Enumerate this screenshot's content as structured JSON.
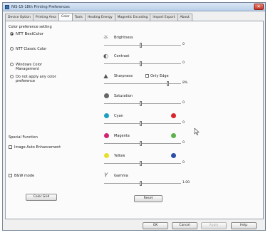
{
  "window": {
    "title": "NIS-15-18th Printing Preferences",
    "close_label": "✕"
  },
  "tabs": [
    {
      "label": "Device Option"
    },
    {
      "label": "Printing Area"
    },
    {
      "label": "Color"
    },
    {
      "label": "Tools"
    },
    {
      "label": "Heating Energy"
    },
    {
      "label": "Magnetic Encoding"
    },
    {
      "label": "Import Export"
    },
    {
      "label": "About"
    }
  ],
  "left": {
    "color_pref_heading": "Color preference setting",
    "opt_bestcolor": "NTT BestColor",
    "opt_classic": "NTT Classic Color",
    "opt_windows_line1": "Windows Color",
    "opt_windows_line2": "Management",
    "opt_none_line1": "Do not apply any color",
    "opt_none_line2": "preference",
    "special_heading": "Special Function",
    "image_auto": "Image Auto Enhancement",
    "bw_mode": "B&W mode",
    "color_grid_btn": "Color Grid"
  },
  "adjust": {
    "brightness": {
      "label": "Brightness",
      "value": "0"
    },
    "contrast": {
      "label": "Contrast",
      "value": "0"
    },
    "sharpness": {
      "label": "Sharpness",
      "edge_label": "Only Edge",
      "value": "8%"
    },
    "saturation": {
      "label": "Saturation",
      "value": "0"
    },
    "cyan": {
      "label": "Cyan",
      "value": "0"
    },
    "magenta": {
      "label": "Magenta",
      "value": "0"
    },
    "yellow": {
      "label": "Yellow",
      "value": "0"
    },
    "gamma": {
      "label": "Gamma",
      "value": "1.00"
    },
    "reset_btn": "Reset"
  },
  "footer": {
    "ok": "OK",
    "cancel": "Cancel",
    "apply": "Apply",
    "help": "Help"
  },
  "colors": {
    "cyan": "#1a9fc0",
    "red": "#d9252b",
    "magenta": "#d3236f",
    "green": "#5bb34a",
    "yellow": "#e6e02a",
    "blue": "#2b4fa8"
  }
}
